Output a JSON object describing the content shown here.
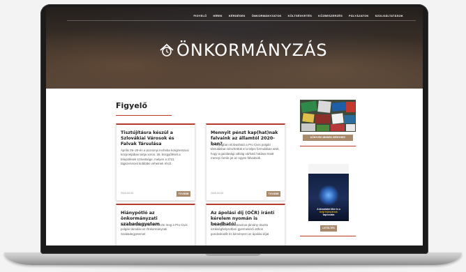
{
  "nav": {
    "items": [
      "FIGYELŐ",
      "HÍREK",
      "KÉRDÉSEK",
      "ÖNKORMÁNYZATOK",
      "KÖLTSÉGVETÉS",
      "KÖZBESZERZÉS",
      "PÁLYÁZATOK",
      "SZOLGÁLTATÁSOK"
    ]
  },
  "logo": {
    "text": "ÖNKORMÁNYZÁS",
    "mark_icon": "house-clock-icon"
  },
  "page": {
    "title": "Figyelő"
  },
  "articles": [
    {
      "title": "Tisztújításra készül a Szlovákiai Városok és Falvak Társulása",
      "excerpt": "Április 26–29-én a pozsonyi Incheba kongresszusi központjában tartja soros, 26. közgyűlését a települések szövetsége, melyen a 2741 tagszervezet küldöttei vehetnek részt.",
      "date": "2023-04-03",
      "button": "TOVÁBB"
    },
    {
      "title": "Mennyit pénzt kap(hat)nak falvaink az államtól 2020-ban?",
      "excerpt": "Az anyagban elolvasható a Pro Civis polgári társulásban készítettük el a teljes formulában amit, hogy a gazdasági válság várható hatásai miatt mennyi forrás jut az egyes falvaknak.",
      "date": "2020-04-03",
      "button": "TOVÁBB"
    },
    {
      "title": "Hiánypótló az önkormányzati szabadegyetem",
      "excerpt": "Kilencedik alkalommal szervezte meg a Pro Civis polgári társulás az Önkormányzati Szabadegyetemet",
      "date": "",
      "button": ""
    },
    {
      "title": "Az ápolási díj (OČR) iránti kérelem nyomán is beadható!",
      "excerpt": "Amennyiben a koronavírus-járvány okozta szükséghelyzetben gyermekérő otthon gondoskodik és kérvényezi az ápolási díjat",
      "date": "",
      "button": ""
    }
  ],
  "sidebar": {
    "button1": "KÖNYVEK MINDEN IGÉNYHEZ!",
    "ad2_caption_top": "A társadalmi tőke és a",
    "ad2_caption_highlight": "helyi fejlesztések",
    "ad2_caption_bottom": "kapcsolata",
    "button2": "LETÖLTÉS"
  },
  "colors": {
    "accent_red": "#b33a2c",
    "button_tan": "#a8896b"
  }
}
